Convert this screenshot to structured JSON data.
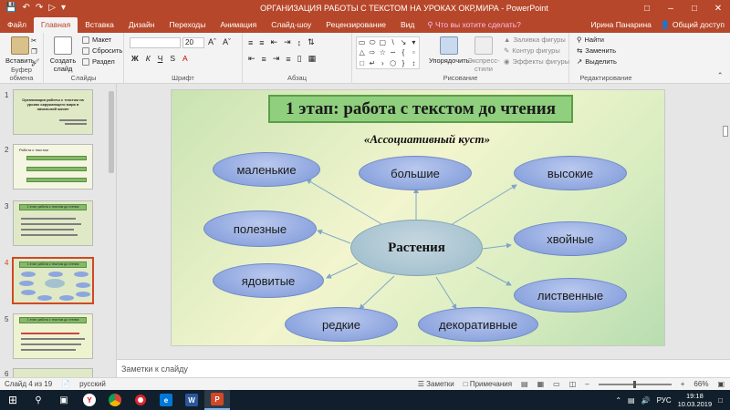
{
  "window": {
    "title": "ОРГАНИЗАЦИЯ РАБОТЫ С ТЕКСТОМ НА УРОКАХ ОКР,МИРА  -  PowerPoint",
    "user": "Ирина Панарина",
    "share": "Общий доступ"
  },
  "tabs": [
    "Файл",
    "Главная",
    "Вставка",
    "Дизайн",
    "Переходы",
    "Анимация",
    "Слайд-шоу",
    "Рецензирование",
    "Вид"
  ],
  "active_tab": "Главная",
  "tell_me": "Что вы хотите сделать?",
  "ribbon": {
    "clipboard": {
      "paste": "Вставить",
      "label": "Буфер обмена"
    },
    "slides": {
      "create": "Создать слайд",
      "layout": "Макет",
      "reset": "Сбросить",
      "section": "Раздел",
      "label": "Слайды"
    },
    "font": {
      "size": "20",
      "bold": "Ж",
      "italic": "К",
      "underline": "Ч",
      "strike": "S",
      "label": "Шрифт"
    },
    "paragraph": {
      "label": "Абзац"
    },
    "drawing": {
      "arrange": "Упорядочить",
      "quick_styles": "Экспресс-стили",
      "fill": "Заливка фигуры",
      "outline": "Контур фигуры",
      "effects": "Эффекты фигуры",
      "label": "Рисование"
    },
    "editing": {
      "find": "Найти",
      "replace": "Заменить",
      "select": "Выделить",
      "label": "Редактирование"
    }
  },
  "thumbnails": [
    {
      "num": "1",
      "title": "Организация работы с текстом на уроках окружающего мира в начальной школе"
    },
    {
      "num": "2",
      "title": "Работа с текстом"
    },
    {
      "num": "3",
      "title": "1 этап: работа с текстом до чтения"
    },
    {
      "num": "4",
      "title": "1 этап: работа с текстом до чтения"
    },
    {
      "num": "5",
      "title": "1 этап: работа с текстом до чтения"
    },
    {
      "num": "6",
      "title": ""
    }
  ],
  "slide": {
    "title": "1 этап: работа с текстом до чтения",
    "subtitle": "«Ассоциативный куст»",
    "center": "Растения",
    "words": {
      "small": "маленькие",
      "big": "большие",
      "tall": "высокие",
      "useful": "полезные",
      "coniferous": "хвойные",
      "poisonous": "ядовитые",
      "deciduous": "лиственные",
      "rare": "редкие",
      "decorative": "декоративные"
    }
  },
  "notes_placeholder": "Заметки к слайду",
  "status": {
    "slide_info": "Слайд 4 из 19",
    "language": "русский",
    "notes": "Заметки",
    "comments": "Примечания",
    "zoom": "66%"
  },
  "taskbar": {
    "lang": "РУС",
    "time": "19:18",
    "date": "10.03.2019"
  },
  "colors": {
    "accent": "#b7472a",
    "title_fill": "#8fcf7e",
    "oval_fill": "#8ea6df"
  }
}
